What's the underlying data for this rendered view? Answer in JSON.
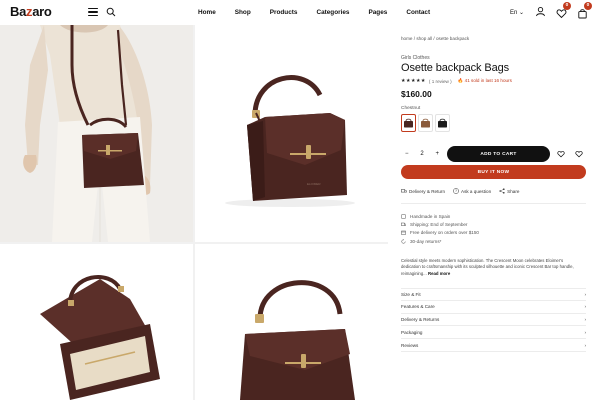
{
  "header": {
    "logo": {
      "text_a": "Ba",
      "text_z": "z",
      "text_b": "aro"
    },
    "nav": [
      "Home",
      "Shop",
      "Products",
      "Categories",
      "Pages",
      "Contact"
    ],
    "language": "En ⌄",
    "wishlist_count": "0",
    "cart_count": "0"
  },
  "breadcrumb": "home / shop all / osette backpack",
  "product": {
    "category": "Girls Clothes",
    "title": "Osette backpack Bags",
    "stars": "★★★★★",
    "reviews": "( 1 review )",
    "sold": "🔥 41 sold in last 16 hours",
    "price": "$160.00",
    "color_label": "Chestnut",
    "quantity": "2",
    "qty_minus": "−",
    "qty_plus": "+",
    "add_to_cart": "ADD TO CART",
    "buy_now": "BUY IT NOW"
  },
  "actions": [
    "Delivery & Return",
    "Ask a question",
    "Share"
  ],
  "features": [
    "Handmade in Spain",
    "Shipping: End of September",
    "Free delivery on orders over $150",
    "30-day returns*"
  ],
  "description": "Celestial style meets modern sophistication. The Crescent Moon celebrates Eloimer's dedication to craftsmanship with its sculpted silhouette and iconic Crescent Bar top handle, reimagining...",
  "description_more": "Read more",
  "accordion": [
    "Size & Fit",
    "Features & Care",
    "Delivery & Returns",
    "Packaging",
    "Reviews"
  ],
  "accordion_chevron": "›",
  "colors": {
    "accent": "#c23b1e",
    "dark": "#111111",
    "bag": "#4a2520"
  }
}
